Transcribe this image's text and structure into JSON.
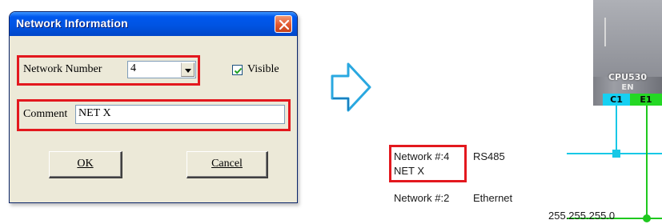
{
  "dialog": {
    "title": "Network Information",
    "network_number_label": "Network Number",
    "network_number_value": "4",
    "visible_label": "Visible",
    "visible_checked": true,
    "comment_label": "Comment",
    "comment_value": "NET X",
    "ok_label": "OK",
    "cancel_label": "Cancel"
  },
  "diagram": {
    "network4_line1_id": "Network #:4",
    "network4_line1_type": "RS485",
    "network4_line2": "NET X",
    "network2_label": "Network #:2",
    "network2_type": "Ethernet",
    "subnet_mask": "255.255.255.0",
    "plc_model": "CPU530",
    "plc_sub": "EN",
    "port_c1": "C1",
    "port_e1": "E1"
  },
  "colors": {
    "highlight": "#e3181e",
    "arrow_fill": "#ffffff",
    "arrow_stroke": "#2aa8e0",
    "rs485_line": "#18c8e6",
    "ethernet_line": "#1ec81e"
  }
}
